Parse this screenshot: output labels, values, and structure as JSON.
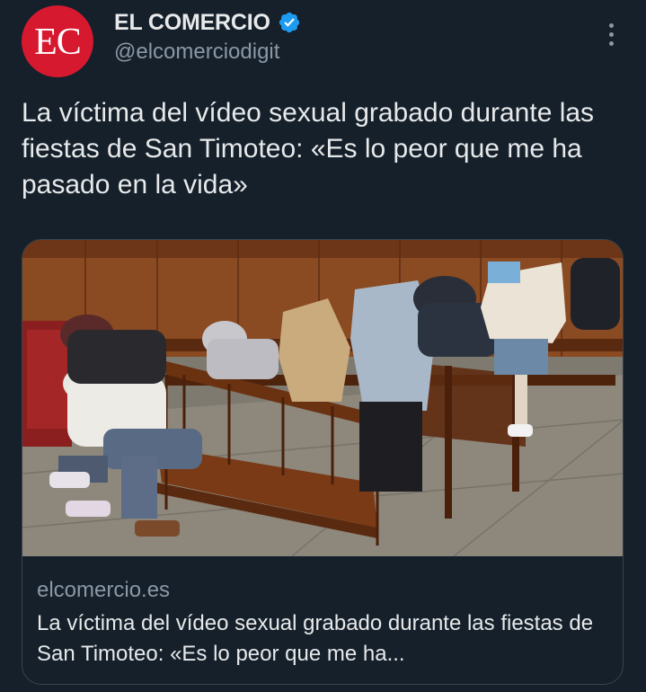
{
  "author": {
    "avatar_text": "EC",
    "display_name": "EL COMERCIO",
    "handle": "@elcomerciodigit",
    "verified": true
  },
  "tweet": {
    "text": "La víctima del vídeo sexual grabado durante las fiestas de San Timoteo: «Es lo peor que me ha pasado en la vida»"
  },
  "card": {
    "domain": "elcomercio.es",
    "title": "La víctima del vídeo sexual grabado durante las fiestas de San Timoteo: «Es lo peor que me ha..."
  },
  "icons": {
    "verified": "verified-badge-icon",
    "more": "more-options-icon"
  },
  "colors": {
    "background": "#15202b",
    "brand_red": "#d7192f",
    "verified_blue": "#1d9bf0",
    "secondary_text": "#8b98a5",
    "primary_text": "#e7e9ea",
    "card_border": "#38444d"
  }
}
